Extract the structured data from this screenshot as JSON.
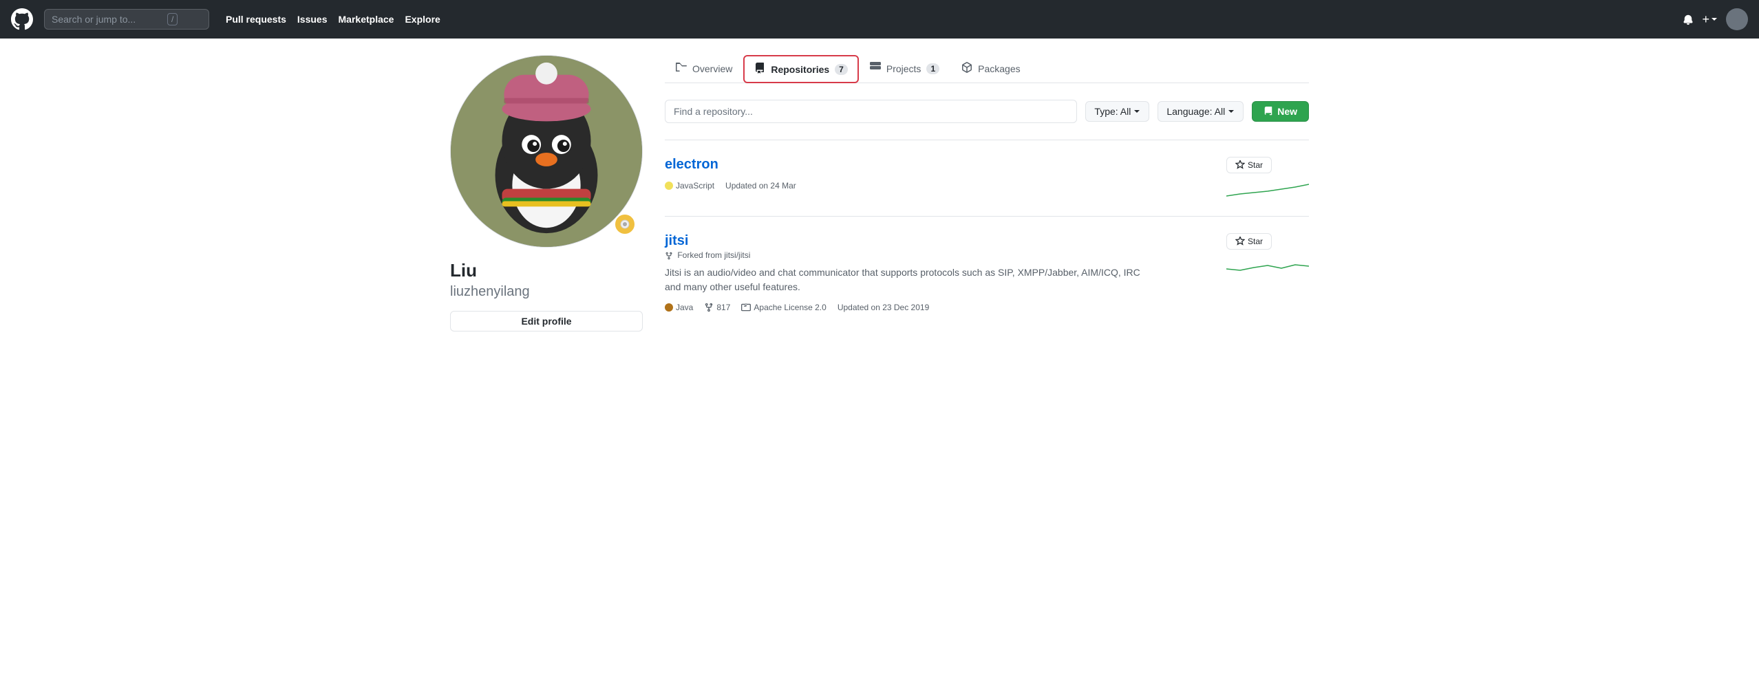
{
  "nav": {
    "search_placeholder": "Search or jump to...",
    "shortcut": "/",
    "links": [
      "Pull requests",
      "Issues",
      "Marketplace",
      "Explore"
    ],
    "logo_label": "GitHub",
    "bell_icon": "🔔",
    "plus_label": "+",
    "avatar_label": "User avatar"
  },
  "sidebar": {
    "display_name": "Liu",
    "username": "liuzhenyilang",
    "edit_profile_label": "Edit profile"
  },
  "tabs": [
    {
      "id": "overview",
      "label": "Overview",
      "icon": "📖",
      "count": null,
      "active": false
    },
    {
      "id": "repositories",
      "label": "Repositories",
      "icon": "📦",
      "count": "7",
      "active": true
    },
    {
      "id": "projects",
      "label": "Projects",
      "icon": "📋",
      "count": "1",
      "active": false
    },
    {
      "id": "packages",
      "label": "Packages",
      "icon": "📦",
      "count": null,
      "active": false
    }
  ],
  "filters": {
    "search_placeholder": "Find a repository...",
    "type_label": "Type: All",
    "language_label": "Language: All",
    "new_label": "New"
  },
  "repos": [
    {
      "id": "electron",
      "name": "electron",
      "fork": false,
      "fork_label": "",
      "description": "",
      "language": "JavaScript",
      "lang_color": "#f1e05a",
      "stars": null,
      "forks": null,
      "license": null,
      "updated": "Updated on 24 Mar",
      "sparkline_color": "#2ea44f"
    },
    {
      "id": "jitsi",
      "name": "jitsi",
      "fork": true,
      "fork_label": "Forked from jitsi/jitsi",
      "description": "Jitsi is an audio/video and chat communicator that supports protocols such as SIP, XMPP/Jabber, AIM/ICQ, IRC and many other useful features.",
      "language": "Java",
      "lang_color": "#b07219",
      "stars": null,
      "forks": "817",
      "license": "Apache License 2.0",
      "updated": "Updated on 23 Dec 2019",
      "sparkline_color": "#2ea44f"
    }
  ]
}
